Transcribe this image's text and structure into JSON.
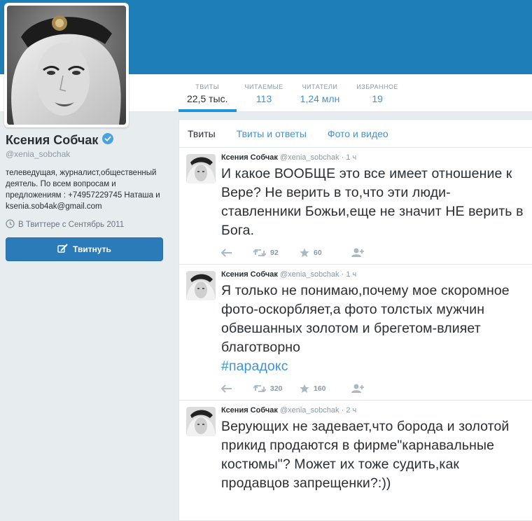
{
  "profile": {
    "name": "Ксения Собчак",
    "handle": "@xenia_sobchak",
    "bio": "телеведущая, журналист,общественный деятель. По всем вопросам и предложениям : +74957229745 Наташа и ksenia.sob4ak@gmail.com",
    "joined": "В Твиттере с Сентябрь 2011",
    "tweet_button": "Твитнуть"
  },
  "stats": [
    {
      "label": "ТВИТЫ",
      "value": "22,5 тыс."
    },
    {
      "label": "ЧИТАЕМЫЕ",
      "value": "113"
    },
    {
      "label": "ЧИТАТЕЛИ",
      "value": "1,24 млн"
    },
    {
      "label": "ИЗБРАННОЕ",
      "value": "19"
    }
  ],
  "tabs": [
    "Твиты",
    "Твиты и ответы",
    "Фото и видео"
  ],
  "tweets": [
    {
      "name": "Ксения Собчак",
      "handle": "@xenia_sobchak",
      "time": "1 ч",
      "text": "И какое ВООБЩЕ это все имеет отношение к Вере? Не верить в то,что эти люди-ставленники Божьи,еще не значит НЕ верить в Бога.",
      "hashtag": "",
      "retweets": "92",
      "favorites": "60"
    },
    {
      "name": "Ксения Собчак",
      "handle": "@xenia_sobchak",
      "time": "1 ч",
      "text": "Я только не понимаю,почему мое скоромное фото-оскорбляет,а фото толстых мужчин обвешанных золотом и брегетом-влияет благотворно",
      "hashtag": "#парадокс",
      "retweets": "320",
      "favorites": "160"
    },
    {
      "name": "Ксения Собчак",
      "handle": "@xenia_sobchak",
      "time": "2 ч",
      "text": "Верующих не задевает,что борода и золотой прикид продаются в фирме\"карнавальные костюмы\"? Может их тоже судить,как продавцов запрещенки?:))",
      "hashtag": "",
      "retweets": "",
      "favorites": ""
    }
  ],
  "colors": {
    "banner": "#1e7fb8",
    "link": "#3b94d9",
    "tweet_button": "#2b7bb9",
    "muted": "#8899a6"
  },
  "icons": [
    "verified-badge-icon",
    "calendar-clock-icon",
    "quill-icon",
    "reply-icon",
    "retweet-icon",
    "star-icon",
    "follow-icon"
  ]
}
